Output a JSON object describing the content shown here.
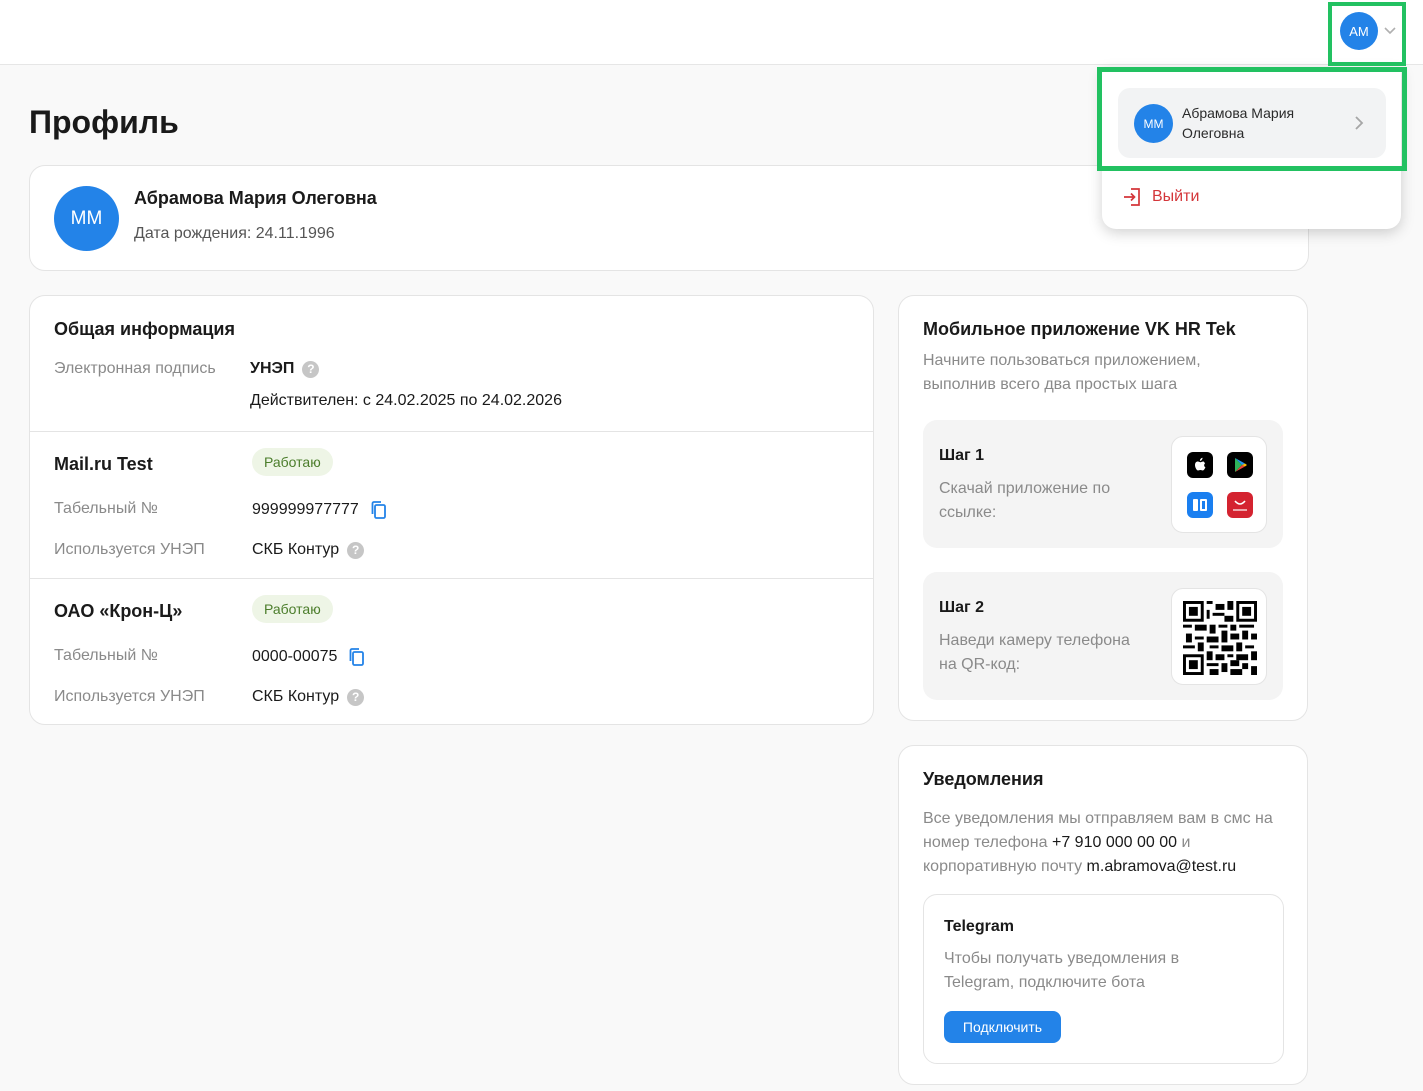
{
  "header": {
    "avatar_initials": "AM"
  },
  "dropdown": {
    "avatar_initials": "MM",
    "user_name": "Абрамова Мария Олеговна",
    "logout_label": "Выйти"
  },
  "page": {
    "title": "Профиль"
  },
  "profile": {
    "initials": "MM",
    "name": "Абрамова Мария Олеговна",
    "birth_date": "Дата рождения: 24.11.1996"
  },
  "general": {
    "title": "Общая информация",
    "signature_label": "Электронная подпись",
    "signature_value": "УНЭП",
    "signature_validity": "Действителен: с 24.02.2025 по 24.02.2026",
    "employers": [
      {
        "name": "Mail.ru Test",
        "status": "Работаю",
        "tab_label": "Табельный №",
        "tab_value": "999999977777",
        "unep_label": "Используется УНЭП",
        "unep_value": "СКБ Контур"
      },
      {
        "name": "ОАО «Крон-Ц»",
        "status": "Работаю",
        "tab_label": "Табельный №",
        "tab_value": "0000-00075",
        "unep_label": "Используется УНЭП",
        "unep_value": "СКБ Контур"
      }
    ]
  },
  "mobile_app": {
    "title": "Мобильное приложение VK HR Tek",
    "description": "Начните пользоваться приложением, выполнив всего два простых шага",
    "step1_title": "Шаг 1",
    "step1_text": "Скачай приложение по ссылке:",
    "step2_title": "Шаг 2",
    "step2_text": "Наведи камеру телефона на QR-код:",
    "stores": [
      "apple-app-store-icon",
      "google-play-icon",
      "rustore-icon",
      "huawei-appgallery-icon"
    ]
  },
  "notifications": {
    "title": "Уведомления",
    "text_1": "Все уведомления мы отправляем вам в смс на номер телефона",
    "phone": "+7 910 000 00 00",
    "text_2": "и корпоративную почту",
    "email": "m.abramova@test.ru",
    "telegram_title": "Telegram",
    "telegram_text": "Чтобы получать уведомления в Telegram, подключите бота",
    "connect_label": "Подключить"
  },
  "colors": {
    "accent": "#2383e8",
    "highlight": "#22c161",
    "danger": "#d4363a",
    "badge_bg": "#eef5e6",
    "badge_text": "#4b7d2b"
  }
}
